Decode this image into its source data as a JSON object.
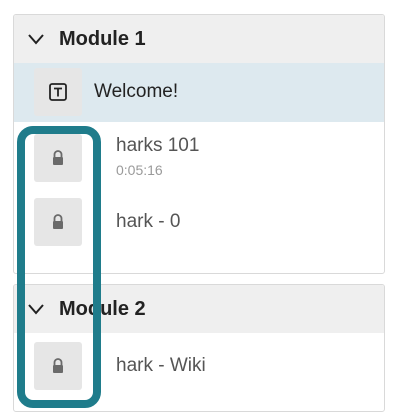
{
  "modules": [
    {
      "title": "Module 1",
      "items": [
        {
          "label": "Welcome!",
          "icon": "text-icon",
          "active": true,
          "locked": false,
          "sub": ""
        },
        {
          "label": "harks 101",
          "icon": "lock-icon",
          "active": false,
          "locked": true,
          "sub": "0:05:16"
        },
        {
          "label": "hark - 0",
          "icon": "lock-icon",
          "active": false,
          "locked": true,
          "sub": ""
        }
      ]
    },
    {
      "title": "Module 2",
      "items": [
        {
          "label": "hark - Wiki",
          "icon": "lock-icon",
          "active": false,
          "locked": true,
          "sub": ""
        }
      ]
    }
  ],
  "colors": {
    "active_bg": "#dde9ef",
    "header_bg": "#efefef",
    "focus_ring": "#1f7c8b",
    "icon_box_bg": "#e6e6e6"
  }
}
